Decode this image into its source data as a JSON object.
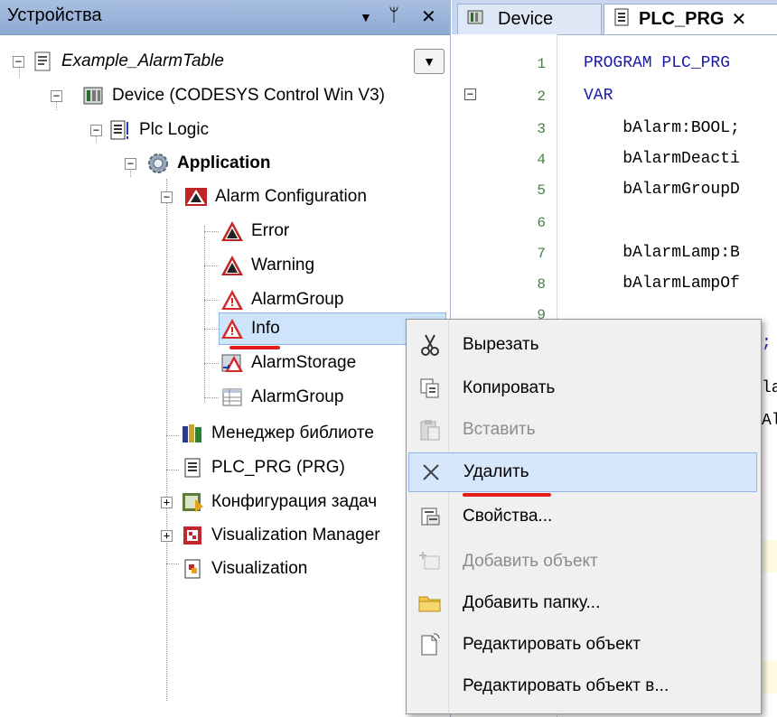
{
  "devices_panel": {
    "title": "Устройства",
    "pin_icon": "pin-icon",
    "close_icon": "close-icon",
    "dropdown_icon": "chevron-down-icon"
  },
  "tree": {
    "project": "Example_AlarmTable",
    "device": "Device (CODESYS Control Win V3)",
    "plc_logic": "Plc Logic",
    "application": "Application",
    "alarm_configuration": "Alarm Configuration",
    "error": "Error",
    "warning": "Warning",
    "alarm_group_1": "AlarmGroup",
    "info": "Info",
    "alarm_storage": "AlarmStorage",
    "alarm_group_2": "AlarmGroup",
    "library_manager": "Менеджер библиоте",
    "plc_prg": "PLC_PRG (PRG)",
    "task_config": "Конфигурация задач",
    "visualization_manager": "Visualization Manager",
    "visualization": "Visualization"
  },
  "editor": {
    "tabs": [
      "Device",
      "PLC_PRG"
    ],
    "lines": [
      {
        "no": "1",
        "text": "PROGRAM PLC_PRG"
      },
      {
        "no": "2",
        "text": "VAR"
      },
      {
        "no": "3",
        "text": "    bAlarm:BOOL;"
      },
      {
        "no": "4",
        "text": "    bAlarmDeacti"
      },
      {
        "no": "5",
        "text": "    bAlarmGroupD"
      },
      {
        "no": "6",
        "text": ""
      },
      {
        "no": "7",
        "text": "    bAlarmLamp:B"
      },
      {
        "no": "8",
        "text": "    bAlarmLampOf"
      },
      {
        "no": "9",
        "text": ""
      }
    ],
    "partial_fragments": [
      ";",
      "la",
      "Al"
    ]
  },
  "context_menu": {
    "items": [
      {
        "label": "Вырезать",
        "icon": "scissors-icon",
        "enabled": true
      },
      {
        "label": "Копировать",
        "icon": "copy-icon",
        "enabled": true
      },
      {
        "label": "Вставить",
        "icon": "paste-icon",
        "enabled": false
      },
      {
        "label": "Удалить",
        "icon": "delete-icon",
        "enabled": true,
        "highlighted": true
      },
      {
        "label": "Свойства...",
        "icon": "properties-icon",
        "enabled": true
      },
      {
        "label": "Добавить объект",
        "icon": "add-object-icon",
        "enabled": false
      },
      {
        "label": "Добавить папку...",
        "icon": "folder-icon",
        "enabled": true
      },
      {
        "label": "Редактировать объект",
        "icon": "edit-object-icon",
        "enabled": true
      },
      {
        "label": "Редактировать объект в...",
        "icon": "",
        "enabled": true
      }
    ]
  },
  "colors": {
    "selection": "#cde4fb",
    "highlight_border": "#8fb6e6",
    "underline": "#e31b1b",
    "keyword": "#1a1aa6"
  }
}
